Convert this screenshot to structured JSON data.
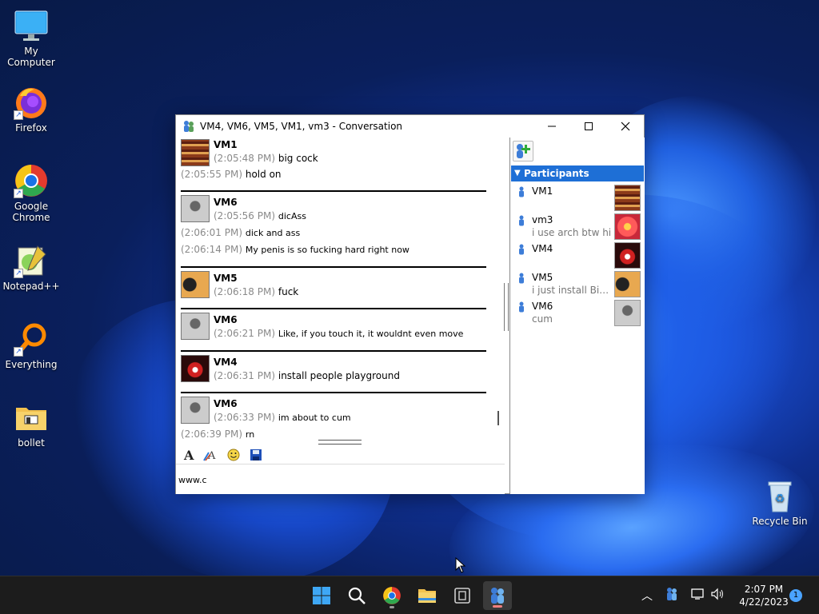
{
  "desktop": {
    "icons": [
      {
        "label": "My Computer"
      },
      {
        "label": "Firefox"
      },
      {
        "label": "Google Chrome"
      },
      {
        "label": "Notepad++"
      },
      {
        "label": "Everything"
      },
      {
        "label": "bollet"
      },
      {
        "label": "Recycle Bin"
      }
    ]
  },
  "window": {
    "title": "VM4, VM6, VM5, VM1, vm3 - Conversation",
    "minimize_icon": "minimize-icon",
    "maximize_icon": "maximize-icon",
    "close_icon": "close-icon"
  },
  "conversation": [
    {
      "sender": "VM1",
      "lines": [
        {
          "time": "(2:05:48 PM)",
          "text": "big cock"
        },
        {
          "time": "(2:05:55 PM)",
          "text": "hold on"
        }
      ]
    },
    {
      "sender": "VM6",
      "lines": [
        {
          "time": "(2:05:56 PM)",
          "text": "dicAss"
        },
        {
          "time": "(2:06:01 PM)",
          "text": "dick and ass"
        },
        {
          "time": "(2:06:14 PM)",
          "text": "My penis is so fucking hard right now"
        }
      ]
    },
    {
      "sender": "VM5",
      "lines": [
        {
          "time": "(2:06:18 PM)",
          "text": "fuck"
        }
      ]
    },
    {
      "sender": "VM6",
      "lines": [
        {
          "time": "(2:06:21 PM)",
          "text": "Like, if you touch it, it wouldnt even move"
        }
      ]
    },
    {
      "sender": "VM4",
      "lines": [
        {
          "time": "(2:06:31 PM)",
          "text": "install people playground"
        }
      ]
    },
    {
      "sender": "VM6",
      "lines": [
        {
          "time": "(2:06:33 PM)",
          "text": "im about to cum"
        },
        {
          "time": "(2:06:39 PM)",
          "text": "rn"
        }
      ]
    }
  ],
  "input": {
    "value": "www.c"
  },
  "participants": {
    "header": "Participants",
    "list": [
      {
        "name": "VM1",
        "status": ""
      },
      {
        "name": "vm3",
        "status": "i use arch btw hi"
      },
      {
        "name": "VM4",
        "status": ""
      },
      {
        "name": "VM5",
        "status": "i just install Big F..."
      },
      {
        "name": "VM6",
        "status": "cum"
      }
    ]
  },
  "taskbar": {
    "time": "2:07 PM",
    "date": "4/22/2023",
    "notifications": "1"
  },
  "colors": {
    "participants_header": "#1e6fd6",
    "timestamp": "#8a8a8a",
    "taskbar": "#1c1c1c"
  }
}
